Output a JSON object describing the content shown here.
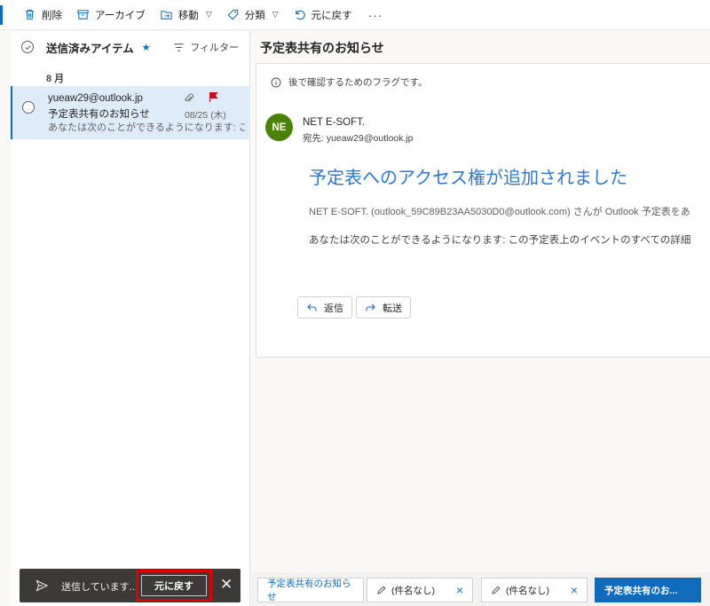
{
  "toolbar": {
    "delete_label": "削除",
    "archive_label": "アーカイブ",
    "move_label": "移動",
    "categorize_label": "分類",
    "undo_label": "元に戻す",
    "more_label": "···"
  },
  "list": {
    "folder_title": "送信済みアイテム",
    "filter_label": "フィルター",
    "group_label": "8 月",
    "items": [
      {
        "sender": "yueaw29@outlook.jp",
        "subject": "予定表共有のお知らせ",
        "preview": "あなたは次のことができるようになります: この...",
        "date": "08/25 (木)"
      }
    ]
  },
  "reading": {
    "subject": "予定表共有のお知らせ",
    "info_text": "後で確認するためのフラグです。",
    "avatar_initials": "NE",
    "from_name": "NET E-SOFT.",
    "to_line": "宛先: yueaw29@outlook.jp",
    "heading": "予定表へのアクセス権が追加されました",
    "line1": "NET E-SOFT. (outlook_59C89B23AA5030D0@outlook.com) さんが Outlook 予定表をあ",
    "line2": "あなたは次のことができるようになります: この予定表上のイベントのすべての詳細",
    "reply_label": "返信",
    "forward_label": "転送"
  },
  "tabs": [
    {
      "label": "予定表共有のお知らせ"
    },
    {
      "label": "(件名なし)"
    },
    {
      "label": "(件名なし)"
    },
    {
      "label": "予定表共有のお..."
    }
  ],
  "snackbar": {
    "status_text": "送信しています...",
    "undo_label": "元に戻す",
    "close_glyph": "✕"
  },
  "colors": {
    "accent": "#0f6cbd",
    "selected_item_bg": "#deecf9",
    "flag": "#c50f1f",
    "avatar": "#498205",
    "heading": "#2b79d0",
    "snackbar_bg": "#3b3a39",
    "highlight_box": "#e00000"
  }
}
